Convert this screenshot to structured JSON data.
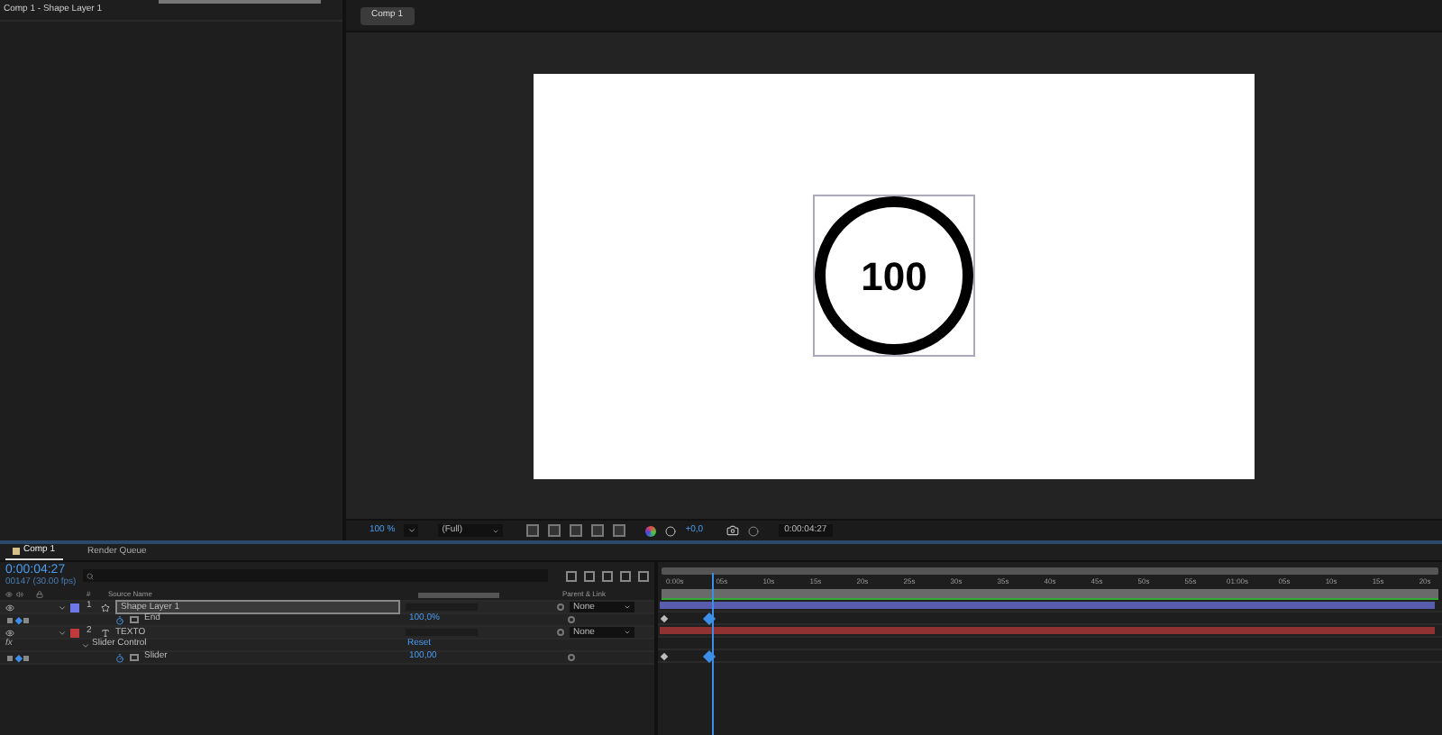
{
  "project_panel": {
    "title": "Comp 1 - Shape Layer 1"
  },
  "viewer": {
    "tab": "Comp 1",
    "counter_text": "100",
    "zoom": "100 %",
    "resolution": "(Full)",
    "exposure": "+0,0",
    "timecode": "0:00:04:27"
  },
  "timeline": {
    "tabs": [
      {
        "label": "Comp 1",
        "selected": true
      },
      {
        "label": "Render Queue",
        "selected": false
      }
    ],
    "timecode": "0:00:04:27",
    "frame_info": "00147 (30.00 fps)",
    "columns": {
      "number": "#",
      "source_name": "Source Name",
      "parent": "Parent & Link"
    },
    "ruler": [
      "0:00s",
      "05s",
      "10s",
      "15s",
      "20s",
      "25s",
      "30s",
      "35s",
      "40s",
      "45s",
      "50s",
      "55s",
      "01:00s",
      "05s",
      "10s",
      "15s",
      "20s"
    ],
    "playhead": {
      "level": 0.064
    },
    "rows": [
      {
        "kind": "shape_layer",
        "number": "1",
        "name": "Shape Layer 1",
        "color": "#6f78e8",
        "selected": true,
        "parent": "None"
      },
      {
        "kind": "property",
        "name": "End",
        "value": "100,0%"
      },
      {
        "kind": "text_layer",
        "number": "2",
        "name": "TEXTO",
        "color": "#c0393b",
        "selected": false,
        "parent": "None"
      },
      {
        "kind": "effect",
        "fx_label": "fx",
        "name": "Slider Control",
        "value": "Reset"
      },
      {
        "kind": "property",
        "name": "Slider",
        "value": "100,00"
      }
    ]
  }
}
